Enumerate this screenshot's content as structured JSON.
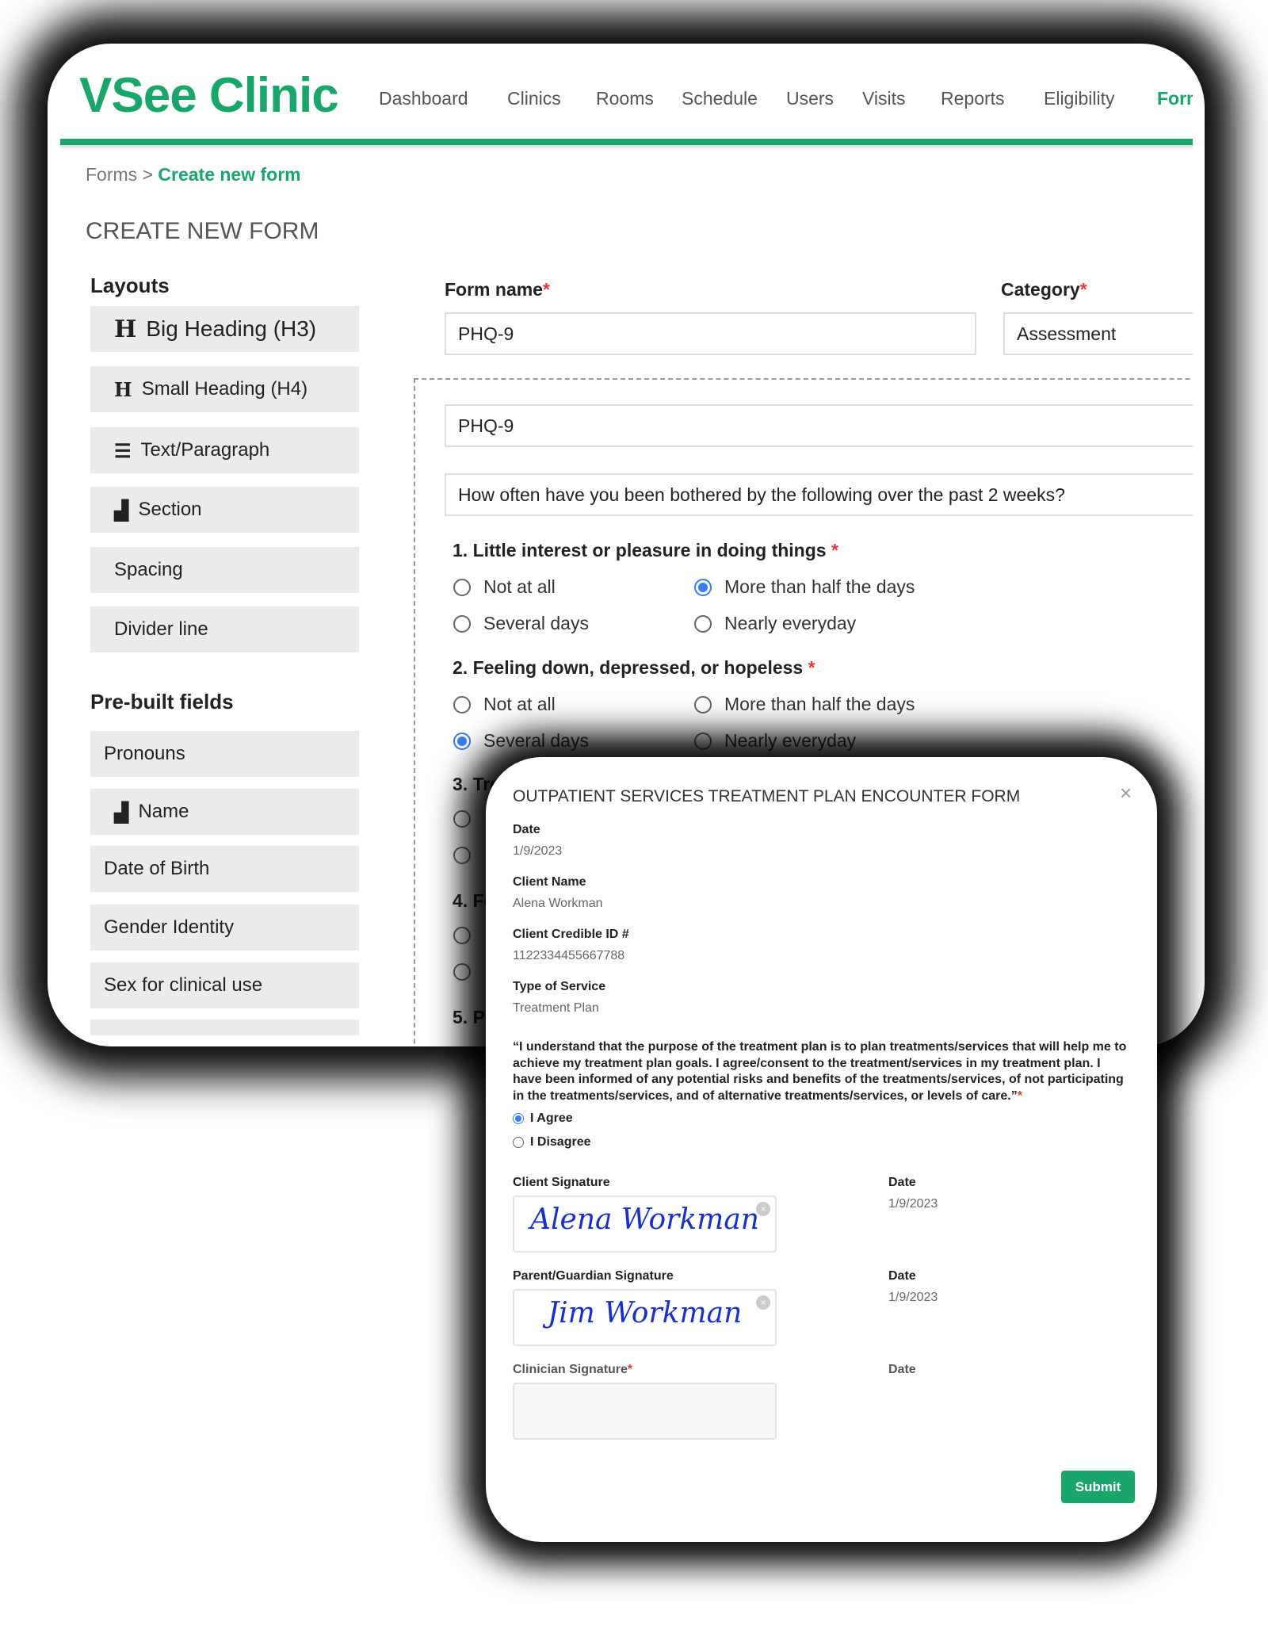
{
  "app": {
    "logo": "VSee Clinic",
    "nav": [
      "Dashboard",
      "Clinics",
      "Rooms",
      "Schedule",
      "Users",
      "Visits",
      "Reports",
      "Eligibility",
      "Forms"
    ],
    "active_nav": "Forms",
    "accent": "#1aa56b"
  },
  "breadcrumb": {
    "parent": "Forms",
    "separator": ">",
    "current": "Create new form"
  },
  "page_title": "CREATE NEW FORM",
  "sidebar": {
    "layouts_label": "Layouts",
    "layouts": [
      {
        "icon": "heading-icon",
        "label": "Big Heading (H3)"
      },
      {
        "icon": "heading-icon",
        "label": "Small Heading (H4)"
      },
      {
        "icon": "paragraph-icon",
        "label": "Text/Paragraph"
      },
      {
        "icon": "section-icon",
        "label": "Section"
      },
      {
        "icon": "",
        "label": "Spacing"
      },
      {
        "icon": "",
        "label": "Divider line"
      }
    ],
    "prebuilt_label": "Pre-built fields",
    "prebuilt": [
      {
        "icon": "",
        "label": "Pronouns"
      },
      {
        "icon": "section-icon",
        "label": "Name"
      },
      {
        "icon": "",
        "label": "Date of Birth"
      },
      {
        "icon": "",
        "label": "Gender Identity"
      },
      {
        "icon": "",
        "label": "Sex for clinical use"
      },
      {
        "icon": "",
        "label": ""
      }
    ]
  },
  "form": {
    "name_label": "Form name",
    "name_value": "PHQ-9",
    "category_label": "Category",
    "category_value": "Assessment",
    "heading_value": "PHQ-9",
    "intro_value": "How often have you been bothered by the following over the past 2 weeks?",
    "questions": [
      {
        "label": "1. Little interest or pleasure in doing things",
        "options": [
          "Not at all",
          "Several days",
          "More than half the days",
          "Nearly everyday"
        ],
        "selected": "More than half the days"
      },
      {
        "label": "2. Feeling down, depressed, or hopeless",
        "options": [
          "Not at all",
          "Several days",
          "More than half the days",
          "Nearly everyday"
        ],
        "selected": "Several days"
      },
      {
        "label": "3. Tro",
        "options": [
          "",
          ""
        ],
        "selected": ""
      },
      {
        "label": "4. Fe",
        "options": [
          "",
          ""
        ],
        "selected": ""
      },
      {
        "label": "5. Po",
        "options": [],
        "selected": ""
      }
    ]
  },
  "modal": {
    "title": "OUTPATIENT SERVICES TREATMENT PLAN ENCOUNTER FORM",
    "fields": [
      {
        "label": "Date",
        "value": "1/9/2023"
      },
      {
        "label": "Client Name",
        "value": "Alena Workman"
      },
      {
        "label": "Client Credible ID #",
        "value": "1122334455667788"
      },
      {
        "label": "Type of Service",
        "value": "Treatment Plan"
      }
    ],
    "consent": "“I understand that the purpose of the treatment plan is to plan treatments/services that will help me to achieve my treatment plan goals. I agree/consent to the treatment/services in my treatment plan. I have been informed of any potential risks and benefits of the treatments/services, of not participating in the treatments/services, and of alternative treatments/services, or levels of care.”",
    "agree": "I Agree",
    "disagree": "I Disagree",
    "selected": "I Agree",
    "signatures": [
      {
        "label": "Client Signature",
        "signature": "Alena Workman",
        "date_label": "Date",
        "date": "1/9/2023"
      },
      {
        "label": "Parent/Guardian Signature",
        "signature": "Jim Workman",
        "date_label": "Date",
        "date": "1/9/2023"
      },
      {
        "label": "Clinician Signature",
        "signature": "",
        "date_label": "Date",
        "date": ""
      }
    ],
    "submit": "Submit"
  }
}
